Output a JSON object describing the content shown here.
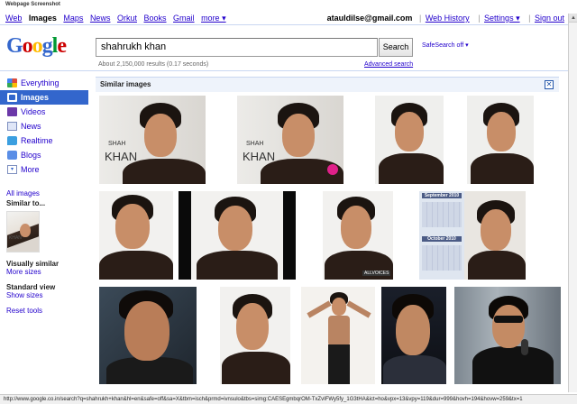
{
  "window": {
    "label": "Webpage Screenshot"
  },
  "topbar": {
    "links": [
      "Web",
      "Images",
      "Maps",
      "News",
      "Orkut",
      "Books",
      "Gmail",
      "more ▾"
    ],
    "current": "Images",
    "user": "atauldilse@gmail.com",
    "web_history": "Web History",
    "settings": "Settings ▾",
    "sign_out": "Sign out"
  },
  "logo": {
    "letters": [
      "G",
      "o",
      "o",
      "g",
      "l",
      "e"
    ]
  },
  "search": {
    "query": "shahrukh khan",
    "button": "Search",
    "safesearch": "SafeSearch off ▾",
    "stats": "About 2,150,000 results (0.17 seconds)",
    "advanced": "Advanced search"
  },
  "sidebar": {
    "items": [
      {
        "label": "Everything",
        "icon": "everything-icon"
      },
      {
        "label": "Images",
        "icon": "images-icon",
        "selected": true
      },
      {
        "label": "Videos",
        "icon": "videos-icon"
      },
      {
        "label": "News",
        "icon": "news-icon"
      },
      {
        "label": "Realtime",
        "icon": "realtime-icon"
      },
      {
        "label": "Blogs",
        "icon": "blogs-icon"
      },
      {
        "label": "More",
        "icon": "more-icon"
      }
    ],
    "all_images": "All images",
    "similar_to": "Similar to...",
    "thumb_text": "KHAN",
    "visually_similar": "Visually similar",
    "more_sizes": "More sizes",
    "standard_view": "Standard view",
    "show_sizes": "Show sizes",
    "reset_tools": "Reset tools"
  },
  "similar": {
    "title": "Similar images",
    "close": "✕",
    "overlay_shah": "SHAH",
    "overlay_khan": "KHAN",
    "overlay_allvoices": "ALLVOICES",
    "cal_sep": "September 2010",
    "cal_oct": "October 2010"
  },
  "status": {
    "url": "http://www.google.co.in/search?q=shahrukh+khan&hl=en&safe=off&sa=X&tbm=isch&prmd=ivnsulo&tbs=simg:CAESEgmbqrOM-TxZvIFWy5fy_1G3tHA&ict=ho&vpx=13&vpy=119&dur=999&hovh=194&hovw=259&tx=1"
  },
  "colors": {
    "link": "#2200cc",
    "nav_selected": "#3366cc",
    "rule": "#c9d7f1",
    "similar_bar": "#eef3fb"
  }
}
